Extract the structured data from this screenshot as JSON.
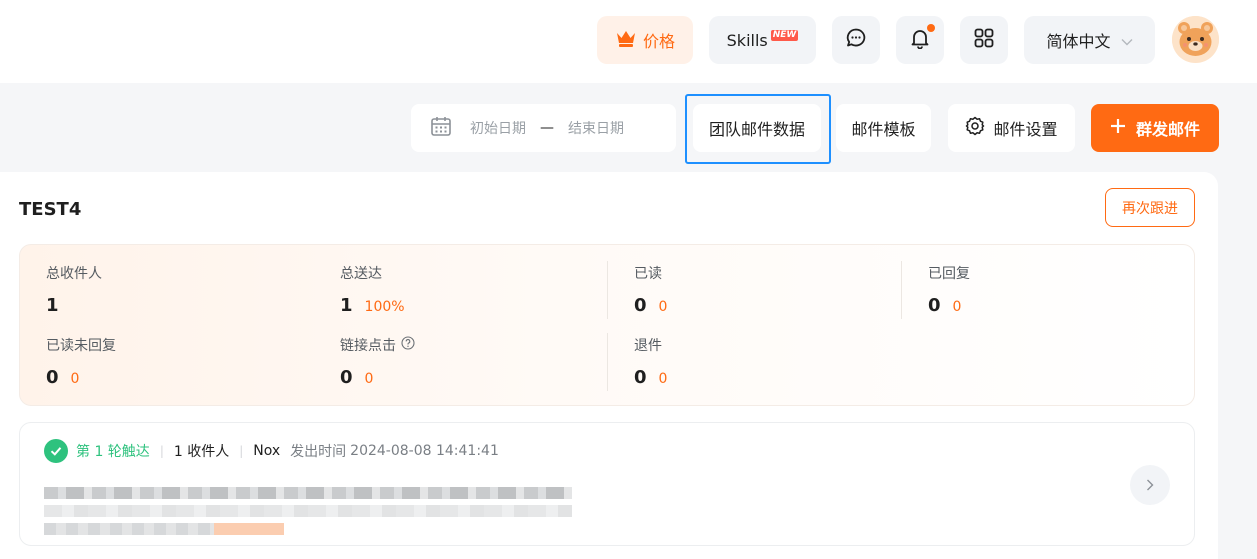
{
  "header": {
    "price_label": "价格",
    "skills_label": "Skills",
    "skills_badge": "NEW",
    "language": "简体中文",
    "icons": {
      "price": "crown-icon",
      "chat": "chat-icon",
      "notifications": "bell-icon",
      "apps": "grid-icon",
      "language": "chevron-down-icon",
      "avatar": "bear-avatar-icon"
    },
    "has_notification_dot": true
  },
  "toolbar": {
    "start_date_placeholder": "初始日期",
    "range_separator": "—",
    "end_date_placeholder": "结束日期",
    "team_data_label": "团队邮件数据",
    "template_label": "邮件模板",
    "settings_label": "邮件设置",
    "mass_send_label": "群发邮件",
    "icons": {
      "calendar": "calendar-icon",
      "settings": "gear-icon",
      "add": "plus-icon"
    }
  },
  "campaign": {
    "title": "TEST4",
    "follow_up_label": "再次跟进",
    "stats": [
      {
        "label": "总收件人",
        "value": "1",
        "extra": ""
      },
      {
        "label": "总送达",
        "value": "1",
        "extra": "100%"
      },
      {
        "label": "已读",
        "value": "0",
        "extra": "0"
      },
      {
        "label": "已回复",
        "value": "0",
        "extra": "0"
      },
      {
        "label": "已读未回复",
        "value": "0",
        "extra": "0"
      },
      {
        "label": "链接点击",
        "value": "0",
        "extra": "0",
        "info_icon": "help-icon"
      },
      {
        "label": "退件",
        "value": "0",
        "extra": "0"
      }
    ]
  },
  "round": {
    "round_label": "第 1 轮触达",
    "recipients": "1 收件人",
    "sender": "Nox",
    "sent_time_label": "发出时间",
    "sent_time": "2024-08-08 14:41:41"
  },
  "colors": {
    "accent": "#ff6a13",
    "success": "#2ec27e",
    "highlight_border": "#1e90ff",
    "background": "#f5f6f8"
  }
}
